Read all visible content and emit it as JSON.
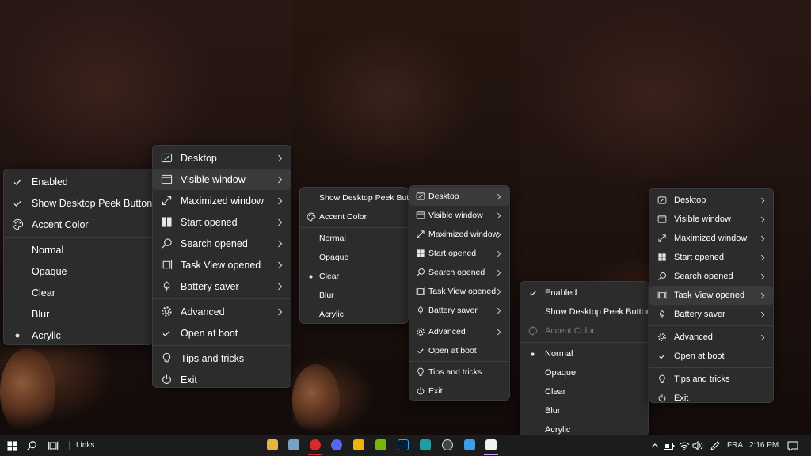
{
  "panel1": {
    "left_menu": {
      "items": [
        {
          "label": "Enabled",
          "icon": "check-icon",
          "checked": true
        },
        {
          "label": "Show Desktop Peek Button",
          "icon": "check-icon",
          "checked": true
        },
        {
          "label": "Accent Color",
          "icon": "palette-icon"
        },
        {
          "label": "Normal"
        },
        {
          "label": "Opaque"
        },
        {
          "label": "Clear"
        },
        {
          "label": "Blur"
        },
        {
          "label": "Acrylic",
          "icon": "bullet-icon",
          "selected": true
        }
      ]
    },
    "right_menu": {
      "items": [
        {
          "label": "Desktop",
          "icon": "desktop-icon"
        },
        {
          "label": "Visible window",
          "icon": "window-icon"
        },
        {
          "label": "Maximized window",
          "icon": "maximize-icon"
        },
        {
          "label": "Start opened",
          "icon": "windows-logo-icon"
        },
        {
          "label": "Search opened",
          "icon": "search-icon"
        },
        {
          "label": "Task View opened",
          "icon": "task-view-icon"
        },
        {
          "label": "Battery saver",
          "icon": "leaf-icon"
        },
        {
          "label": "Advanced",
          "icon": "gear-icon"
        },
        {
          "label": "Open at boot",
          "icon": "check-icon"
        },
        {
          "label": "Tips and tricks",
          "icon": "lightbulb-icon"
        },
        {
          "label": "Exit",
          "icon": "power-icon"
        }
      ]
    }
  },
  "panel2": {
    "left_menu": {
      "items": [
        {
          "label": "Show Desktop Peek Button"
        },
        {
          "label": "Accent Color",
          "icon": "palette-icon"
        },
        {
          "label": "Normal"
        },
        {
          "label": "Opaque"
        },
        {
          "label": "Clear",
          "icon": "bullet-icon",
          "selected": true
        },
        {
          "label": "Blur"
        },
        {
          "label": "Acrylic"
        }
      ]
    },
    "right_menu": {
      "items": [
        {
          "label": "Desktop"
        },
        {
          "label": "Visible window"
        },
        {
          "label": "Maximized window"
        },
        {
          "label": "Start opened"
        },
        {
          "label": "Search opened"
        },
        {
          "label": "Task View opened"
        },
        {
          "label": "Battery saver"
        },
        {
          "label": "Advanced"
        },
        {
          "label": "Open at boot"
        },
        {
          "label": "Tips and tricks"
        },
        {
          "label": "Exit"
        }
      ]
    }
  },
  "panel3": {
    "left_menu": {
      "items": [
        {
          "label": "Enabled",
          "checked": true
        },
        {
          "label": "Show Desktop Peek Button"
        },
        {
          "label": "Accent Color",
          "disabled": true
        },
        {
          "label": "Normal",
          "selected": true
        },
        {
          "label": "Opaque"
        },
        {
          "label": "Clear"
        },
        {
          "label": "Blur"
        },
        {
          "label": "Acrylic"
        }
      ]
    },
    "right_menu": {
      "items": [
        {
          "label": "Desktop"
        },
        {
          "label": "Visible window"
        },
        {
          "label": "Maximized window"
        },
        {
          "label": "Start opened"
        },
        {
          "label": "Search opened"
        },
        {
          "label": "Task View opened"
        },
        {
          "label": "Battery saver"
        },
        {
          "label": "Advanced"
        },
        {
          "label": "Open at boot"
        },
        {
          "label": "Tips and tricks"
        },
        {
          "label": "Exit"
        }
      ]
    }
  },
  "taskbar": {
    "links_label": "Links",
    "language": "FRA",
    "time": "2:16 PM"
  },
  "colors": {
    "menu_bg": "#2c2c2c",
    "menu_hover": "#3a3a3a",
    "taskbar_bg": "#1c1c1c"
  }
}
